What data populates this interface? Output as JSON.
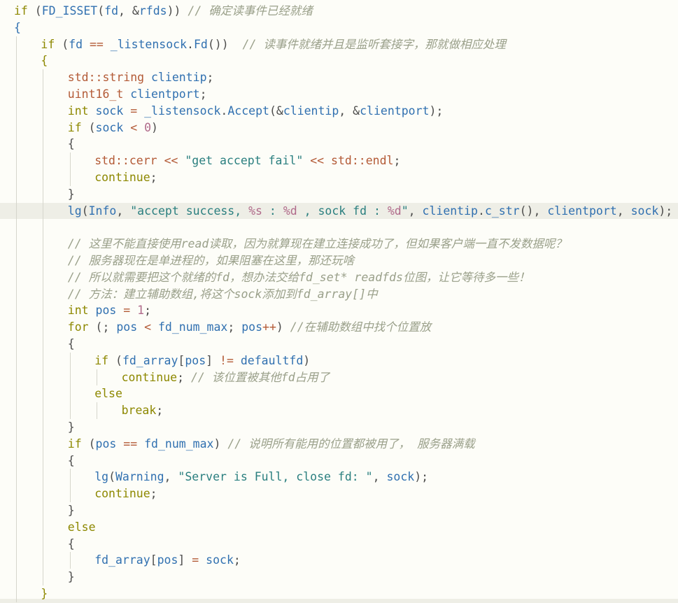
{
  "editor": {
    "language": "cpp",
    "highlighted_line": 13,
    "lines": [
      {
        "indent": 0,
        "tokens": [
          [
            "kw",
            "if"
          ],
          [
            "punc",
            " ("
          ],
          [
            "macro",
            "FD_ISSET"
          ],
          [
            "punc",
            "("
          ],
          [
            "var",
            "fd"
          ],
          [
            "punc",
            ", &"
          ],
          [
            "var",
            "rfds"
          ],
          [
            "punc",
            "))"
          ],
          [
            "cm",
            " // 确定读事件已经就绪"
          ]
        ]
      },
      {
        "indent": 0,
        "tokens": [
          [
            "brace",
            "{"
          ]
        ]
      },
      {
        "indent": 1,
        "tokens": [
          [
            "kw",
            "if"
          ],
          [
            "punc",
            " ("
          ],
          [
            "var",
            "fd"
          ],
          [
            "punc",
            " "
          ],
          [
            "op",
            "=="
          ],
          [
            "punc",
            " "
          ],
          [
            "var",
            "_listensock"
          ],
          [
            "punc",
            "."
          ],
          [
            "fn",
            "Fd"
          ],
          [
            "punc",
            "())"
          ],
          [
            "cm",
            "  // 读事件就绪并且是监听套接字，那就做相应处理"
          ]
        ]
      },
      {
        "indent": 1,
        "tokens": [
          [
            "brace2",
            "{"
          ]
        ]
      },
      {
        "indent": 2,
        "tokens": [
          [
            "ns",
            "std"
          ],
          [
            "op",
            "::"
          ],
          [
            "type",
            "string"
          ],
          [
            "punc",
            " "
          ],
          [
            "var",
            "clientip"
          ],
          [
            "punc",
            ";"
          ]
        ]
      },
      {
        "indent": 2,
        "tokens": [
          [
            "type",
            "uint16_t"
          ],
          [
            "punc",
            " "
          ],
          [
            "var",
            "clientport"
          ],
          [
            "punc",
            ";"
          ]
        ]
      },
      {
        "indent": 2,
        "tokens": [
          [
            "kw2",
            "int"
          ],
          [
            "punc",
            " "
          ],
          [
            "var",
            "sock"
          ],
          [
            "punc",
            " "
          ],
          [
            "op",
            "="
          ],
          [
            "punc",
            " "
          ],
          [
            "var",
            "_listensock"
          ],
          [
            "punc",
            "."
          ],
          [
            "fn",
            "Accept"
          ],
          [
            "punc",
            "(&"
          ],
          [
            "var",
            "clientip"
          ],
          [
            "punc",
            ", &"
          ],
          [
            "var",
            "clientport"
          ],
          [
            "punc",
            ");"
          ]
        ]
      },
      {
        "indent": 2,
        "tokens": [
          [
            "kw",
            "if"
          ],
          [
            "punc",
            " ("
          ],
          [
            "var",
            "sock"
          ],
          [
            "punc",
            " "
          ],
          [
            "op",
            "<"
          ],
          [
            "punc",
            " "
          ],
          [
            "num",
            "0"
          ],
          [
            "punc",
            ")"
          ]
        ]
      },
      {
        "indent": 2,
        "tokens": [
          [
            "plain",
            "{"
          ]
        ]
      },
      {
        "indent": 3,
        "tokens": [
          [
            "ns",
            "std"
          ],
          [
            "op",
            "::"
          ],
          [
            "type",
            "cerr"
          ],
          [
            "punc",
            " "
          ],
          [
            "op",
            "<<"
          ],
          [
            "punc",
            " "
          ],
          [
            "str",
            "\"get accept fail\""
          ],
          [
            "punc",
            " "
          ],
          [
            "op",
            "<<"
          ],
          [
            "punc",
            " "
          ],
          [
            "ns",
            "std"
          ],
          [
            "op",
            "::"
          ],
          [
            "type",
            "endl"
          ],
          [
            "punc",
            ";"
          ]
        ]
      },
      {
        "indent": 3,
        "tokens": [
          [
            "kw",
            "continue"
          ],
          [
            "punc",
            ";"
          ]
        ]
      },
      {
        "indent": 2,
        "tokens": [
          [
            "plain",
            "}"
          ]
        ]
      },
      {
        "indent": 2,
        "tokens": [
          [
            "fn",
            "lg"
          ],
          [
            "punc",
            "("
          ],
          [
            "var",
            "Info"
          ],
          [
            "punc",
            ", "
          ],
          [
            "str",
            "\"accept success, "
          ],
          [
            "fmt",
            "%s"
          ],
          [
            "str",
            " : "
          ],
          [
            "fmt",
            "%d"
          ],
          [
            "str",
            " , sock fd : "
          ],
          [
            "fmt",
            "%d"
          ],
          [
            "str",
            "\""
          ],
          [
            "punc",
            ", "
          ],
          [
            "var",
            "clientip"
          ],
          [
            "punc",
            "."
          ],
          [
            "fn",
            "c_str"
          ],
          [
            "punc",
            "(), "
          ],
          [
            "var",
            "clientport"
          ],
          [
            "punc",
            ", "
          ],
          [
            "var",
            "sock"
          ],
          [
            "punc",
            ");"
          ]
        ]
      },
      {
        "indent": 2,
        "tokens": []
      },
      {
        "indent": 2,
        "tokens": [
          [
            "cm",
            "// 这里不能直接使用read读取，因为就算现在建立连接成功了，但如果客户端一直不发数据呢？"
          ]
        ]
      },
      {
        "indent": 2,
        "tokens": [
          [
            "cm",
            "// 服务器现在是单进程的，如果阻塞在这里，那还玩啥"
          ]
        ]
      },
      {
        "indent": 2,
        "tokens": [
          [
            "cm",
            "// 所以就需要把这个就绪的fd，想办法交给fd_set* readfds位图，让它等待多一些！"
          ]
        ]
      },
      {
        "indent": 2,
        "tokens": [
          [
            "cm",
            "// 方法：建立辅助数组,将这个sock添加到fd_array[]中"
          ]
        ]
      },
      {
        "indent": 2,
        "tokens": [
          [
            "kw2",
            "int"
          ],
          [
            "punc",
            " "
          ],
          [
            "var",
            "pos"
          ],
          [
            "punc",
            " "
          ],
          [
            "op",
            "="
          ],
          [
            "punc",
            " "
          ],
          [
            "num",
            "1"
          ],
          [
            "punc",
            ";"
          ]
        ]
      },
      {
        "indent": 2,
        "tokens": [
          [
            "kw",
            "for"
          ],
          [
            "punc",
            " (; "
          ],
          [
            "var",
            "pos"
          ],
          [
            "punc",
            " "
          ],
          [
            "op",
            "<"
          ],
          [
            "punc",
            " "
          ],
          [
            "var",
            "fd_num_max"
          ],
          [
            "punc",
            "; "
          ],
          [
            "var",
            "pos"
          ],
          [
            "op",
            "++"
          ],
          [
            "punc",
            ") "
          ],
          [
            "cm",
            "//在辅助数组中找个位置放"
          ]
        ]
      },
      {
        "indent": 2,
        "tokens": [
          [
            "plain",
            "{"
          ]
        ]
      },
      {
        "indent": 3,
        "tokens": [
          [
            "kw",
            "if"
          ],
          [
            "punc",
            " ("
          ],
          [
            "var",
            "fd_array"
          ],
          [
            "punc",
            "["
          ],
          [
            "var",
            "pos"
          ],
          [
            "punc",
            "] "
          ],
          [
            "op",
            "!="
          ],
          [
            "punc",
            " "
          ],
          [
            "var",
            "defaultfd"
          ],
          [
            "punc",
            ")"
          ]
        ]
      },
      {
        "indent": 4,
        "tokens": [
          [
            "kw",
            "continue"
          ],
          [
            "punc",
            "; "
          ],
          [
            "cm",
            "// 该位置被其他fd占用了"
          ]
        ]
      },
      {
        "indent": 3,
        "tokens": [
          [
            "kw",
            "else"
          ]
        ]
      },
      {
        "indent": 4,
        "tokens": [
          [
            "kw",
            "break"
          ],
          [
            "punc",
            ";"
          ]
        ]
      },
      {
        "indent": 2,
        "tokens": [
          [
            "plain",
            "}"
          ]
        ]
      },
      {
        "indent": 2,
        "tokens": [
          [
            "kw",
            "if"
          ],
          [
            "punc",
            " ("
          ],
          [
            "var",
            "pos"
          ],
          [
            "punc",
            " "
          ],
          [
            "op",
            "=="
          ],
          [
            "punc",
            " "
          ],
          [
            "var",
            "fd_num_max"
          ],
          [
            "punc",
            ") "
          ],
          [
            "cm",
            "// 说明所有能用的位置都被用了， 服务器满载"
          ]
        ]
      },
      {
        "indent": 2,
        "tokens": [
          [
            "plain",
            "{"
          ]
        ]
      },
      {
        "indent": 3,
        "tokens": [
          [
            "fn",
            "lg"
          ],
          [
            "punc",
            "("
          ],
          [
            "var",
            "Warning"
          ],
          [
            "punc",
            ", "
          ],
          [
            "str",
            "\"Server is Full, close fd: \""
          ],
          [
            "punc",
            ", "
          ],
          [
            "var",
            "sock"
          ],
          [
            "punc",
            ");"
          ]
        ]
      },
      {
        "indent": 3,
        "tokens": [
          [
            "kw",
            "continue"
          ],
          [
            "punc",
            ";"
          ]
        ]
      },
      {
        "indent": 2,
        "tokens": [
          [
            "plain",
            "}"
          ]
        ]
      },
      {
        "indent": 2,
        "tokens": [
          [
            "kw",
            "else"
          ]
        ]
      },
      {
        "indent": 2,
        "tokens": [
          [
            "plain",
            "{"
          ]
        ]
      },
      {
        "indent": 3,
        "tokens": [
          [
            "var",
            "fd_array"
          ],
          [
            "punc",
            "["
          ],
          [
            "var",
            "pos"
          ],
          [
            "punc",
            "] "
          ],
          [
            "op",
            "="
          ],
          [
            "punc",
            " "
          ],
          [
            "var",
            "sock"
          ],
          [
            "punc",
            ";"
          ]
        ]
      },
      {
        "indent": 2,
        "tokens": [
          [
            "plain",
            "}"
          ]
        ]
      },
      {
        "indent": 1,
        "tokens": [
          [
            "brace2",
            "}"
          ]
        ]
      }
    ]
  }
}
